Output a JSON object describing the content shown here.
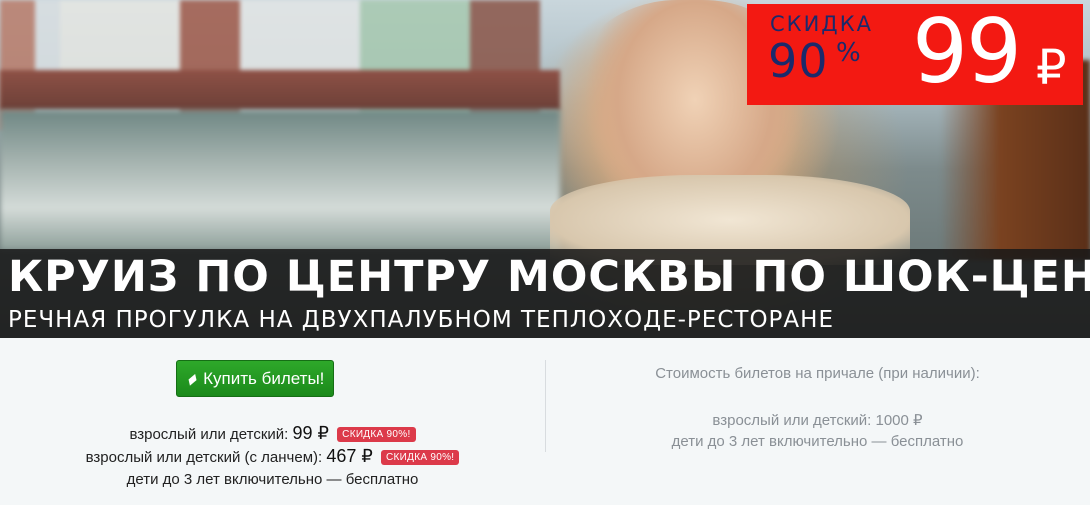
{
  "hero": {
    "discount_label": "СКИДКА",
    "discount_value": "90",
    "discount_pct": "%",
    "big_price": "99",
    "big_currency": "₽",
    "title": "КРУИЗ ПО ЦЕНТРУ МОСКВЫ ПО ШОК-ЦЕНЕ",
    "subtitle": "РЕЧНАЯ ПРОГУЛКА НА ДВУХПАЛУБНОМ ТЕПЛОХОДЕ-РЕСТОРАНЕ",
    "badge_color": "#f31912",
    "badge_text_color": "#1b2a6b"
  },
  "buy": {
    "icon": "ticket-icon",
    "label": "Купить билеты!",
    "color": "#22992a"
  },
  "online_prices": [
    {
      "label": "взрослый или детский: ",
      "amount": "99 ₽",
      "tag": "СКИДКА 90%!"
    },
    {
      "label": "взрослый или детский (с ланчем): ",
      "amount": "467 ₽",
      "tag": "СКИДКА 90%!"
    },
    {
      "label": "дети до 3 лет включительно — бесплатно"
    }
  ],
  "pier": {
    "heading": "Стоимость билетов на причале (при наличии):",
    "line1": "взрослый или детский: 1000 ₽",
    "line2": "дети до 3 лет включительно — бесплатно"
  }
}
